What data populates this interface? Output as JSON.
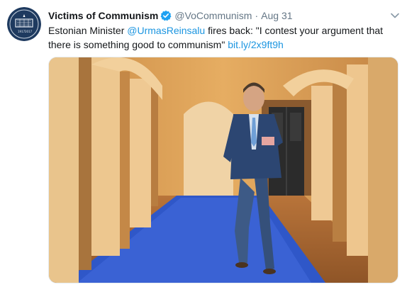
{
  "tweet": {
    "author_name": "Victims of Communism",
    "author_handle": "@VoCommunism",
    "separator": "·",
    "timestamp": "Aug 31",
    "text_before": "Estonian Minister ",
    "mention": "@UrmasReinsalu",
    "text_after": " fires back: \"I contest your argument that there is something good to communism\" ",
    "link": "bit.ly/2x9ft9h",
    "avatar_year_left": "1917",
    "avatar_year_right": "2017"
  },
  "icons": {
    "verified": "verified-badge-icon",
    "caret": "chevron-down-icon",
    "avatar": "victims-of-communism-logo"
  },
  "colors": {
    "link": "#1b95e0",
    "verified": "#1da1f2",
    "secondary_text": "#657786",
    "carpet": "#2f57c8",
    "wall": "#e0a65a"
  }
}
